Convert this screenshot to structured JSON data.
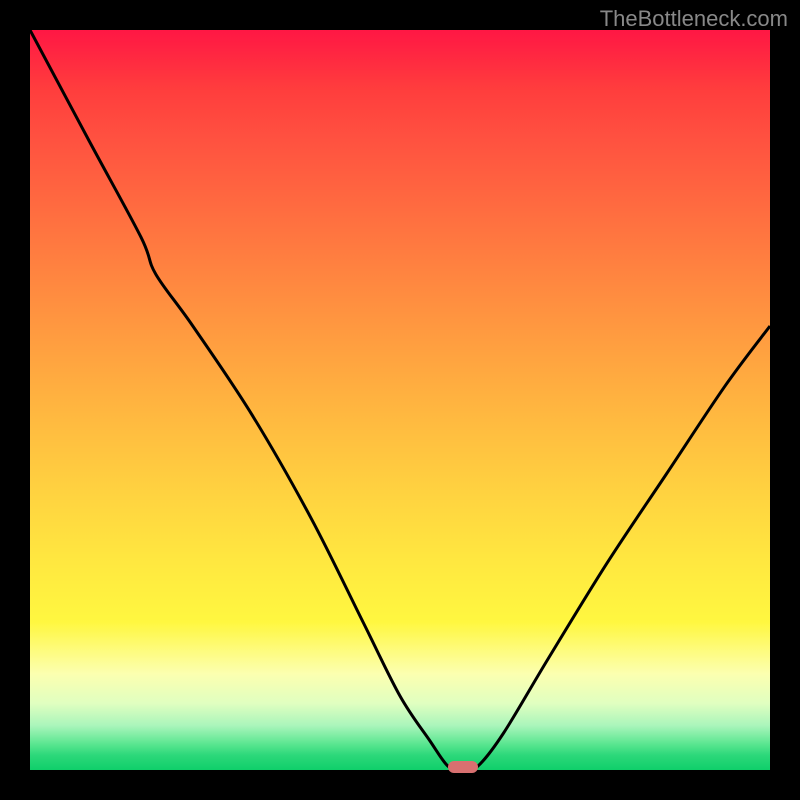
{
  "watermark": "TheBottleneck.com",
  "chart_data": {
    "type": "line",
    "title": "",
    "xlabel": "",
    "ylabel": "",
    "x_range": [
      0,
      100
    ],
    "y_range_percent": [
      0,
      100
    ],
    "curve_points": [
      {
        "x": 0,
        "y": 100
      },
      {
        "x": 8,
        "y": 85
      },
      {
        "x": 15,
        "y": 72
      },
      {
        "x": 17,
        "y": 67
      },
      {
        "x": 22,
        "y": 60
      },
      {
        "x": 30,
        "y": 48
      },
      {
        "x": 38,
        "y": 34
      },
      {
        "x": 45,
        "y": 20
      },
      {
        "x": 50,
        "y": 10
      },
      {
        "x": 54,
        "y": 4
      },
      {
        "x": 56.5,
        "y": 0.5
      },
      {
        "x": 58.5,
        "y": 0
      },
      {
        "x": 60.5,
        "y": 0.5
      },
      {
        "x": 64,
        "y": 5
      },
      {
        "x": 70,
        "y": 15
      },
      {
        "x": 78,
        "y": 28
      },
      {
        "x": 86,
        "y": 40
      },
      {
        "x": 94,
        "y": 52
      },
      {
        "x": 100,
        "y": 60
      }
    ],
    "bottleneck_zone": {
      "x_start": 56.5,
      "x_end": 60.5,
      "y": 0
    },
    "gradient_stops": [
      {
        "pos": 0,
        "color": "#ff1744"
      },
      {
        "pos": 50,
        "color": "#ffd140"
      },
      {
        "pos": 85,
        "color": "#fcffb0"
      },
      {
        "pos": 100,
        "color": "#0fcf6a"
      }
    ]
  }
}
